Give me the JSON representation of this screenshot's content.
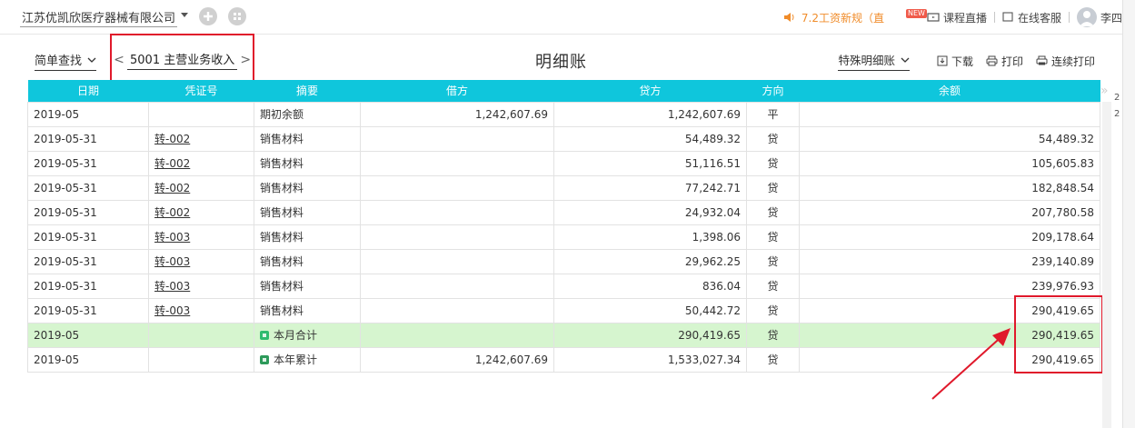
{
  "topbar": {
    "company": "江苏优凯欣医疗器械有限公司",
    "promo": "7.2工资新规（直",
    "new_badge": "NEW",
    "live_course": "课程直播",
    "online_service": "在线客服",
    "user_name": "李四"
  },
  "toolbar": {
    "simple_search": "简单查找",
    "prev": "<",
    "subject": "5001  主营业务收入",
    "next": ">",
    "title": "明细账",
    "special_ledger": "特殊明细账",
    "download": "下载",
    "print": "打印",
    "continuous_print": "连续打印"
  },
  "table": {
    "headers": [
      "日期",
      "凭证号",
      "摘要",
      "借方",
      "贷方",
      "方向",
      "余额"
    ],
    "rows": [
      {
        "date": "2019-05",
        "voucher": "",
        "summary": "期初余额",
        "debit": "1,242,607.69",
        "credit": "1,242,607.69",
        "direction": "平",
        "balance": "",
        "kind": "normal"
      },
      {
        "date": "2019-05-31",
        "voucher": "转-002",
        "summary": "销售材料",
        "debit": "",
        "credit": "54,489.32",
        "direction": "贷",
        "balance": "54,489.32",
        "kind": "normal"
      },
      {
        "date": "2019-05-31",
        "voucher": "转-002",
        "summary": "销售材料",
        "debit": "",
        "credit": "51,116.51",
        "direction": "贷",
        "balance": "105,605.83",
        "kind": "normal"
      },
      {
        "date": "2019-05-31",
        "voucher": "转-002",
        "summary": "销售材料",
        "debit": "",
        "credit": "77,242.71",
        "direction": "贷",
        "balance": "182,848.54",
        "kind": "normal"
      },
      {
        "date": "2019-05-31",
        "voucher": "转-002",
        "summary": "销售材料",
        "debit": "",
        "credit": "24,932.04",
        "direction": "贷",
        "balance": "207,780.58",
        "kind": "normal"
      },
      {
        "date": "2019-05-31",
        "voucher": "转-003",
        "summary": "销售材料",
        "debit": "",
        "credit": "1,398.06",
        "direction": "贷",
        "balance": "209,178.64",
        "kind": "normal"
      },
      {
        "date": "2019-05-31",
        "voucher": "转-003",
        "summary": "销售材料",
        "debit": "",
        "credit": "29,962.25",
        "direction": "贷",
        "balance": "239,140.89",
        "kind": "normal"
      },
      {
        "date": "2019-05-31",
        "voucher": "转-003",
        "summary": "销售材料",
        "debit": "",
        "credit": "836.04",
        "direction": "贷",
        "balance": "239,976.93",
        "kind": "normal"
      },
      {
        "date": "2019-05-31",
        "voucher": "转-003",
        "summary": "销售材料",
        "debit": "",
        "credit": "50,442.72",
        "direction": "贷",
        "balance": "290,419.65",
        "kind": "normal"
      },
      {
        "date": "2019-05",
        "voucher": "",
        "summary": "本月合计",
        "debit": "",
        "credit": "290,419.65",
        "direction": "贷",
        "balance": "290,419.65",
        "kind": "month"
      },
      {
        "date": "2019-05",
        "voucher": "",
        "summary": "本年累计",
        "debit": "1,242,607.69",
        "credit": "1,533,027.34",
        "direction": "贷",
        "balance": "290,419.65",
        "kind": "year"
      }
    ]
  },
  "side_numbers": [
    "2",
    "2"
  ],
  "colors": {
    "header_bg": "#0fc6dc",
    "total_row_bg": "#d6f5cf",
    "annotation_red": "#e0192b",
    "promo_orange": "#f08c2a"
  }
}
